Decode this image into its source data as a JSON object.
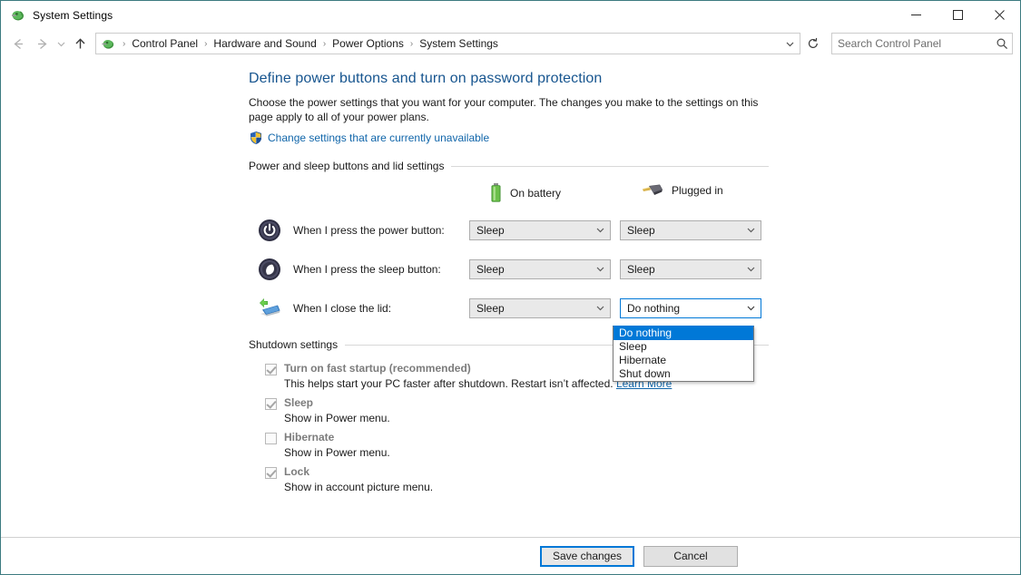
{
  "window": {
    "title": "System Settings",
    "icon": "power-options-icon",
    "caption": {
      "minimize": "minimize-icon",
      "maximize": "maximize-icon",
      "close": "close-icon"
    }
  },
  "addressbar": {
    "back": "back-arrow-icon",
    "forward": "forward-arrow-icon",
    "recent": "recent-pages-icon",
    "up": "up-arrow-icon",
    "breadcrumbs": [
      "Control Panel",
      "Hardware and Sound",
      "Power Options",
      "System Settings"
    ],
    "separator": "›",
    "dropdown": "chevron-down-icon",
    "refresh": "refresh-icon",
    "search": {
      "placeholder": "Search Control Panel",
      "value": "",
      "icon": "search-icon"
    }
  },
  "main": {
    "page_title": "Define power buttons and turn on password protection",
    "description": "Choose the power settings that you want for your computer. The changes you make to the settings on this page apply to all of your power plans.",
    "uac_link": "Change settings that are currently unavailable",
    "group_label": "Power and sleep buttons and lid settings",
    "columns": [
      {
        "label": "On battery",
        "icon": "battery-icon"
      },
      {
        "label": "Plugged in",
        "icon": "power-plug-icon"
      }
    ],
    "rows": [
      {
        "icon": "power-button-icon",
        "label": "When I press the power button:",
        "on_battery": "Sleep",
        "plugged_in": "Sleep"
      },
      {
        "icon": "sleep-button-icon",
        "label": "When I press the sleep button:",
        "on_battery": "Sleep",
        "plugged_in": "Sleep"
      },
      {
        "icon": "laptop-lid-icon",
        "label": "When I close the lid:",
        "on_battery": "Sleep",
        "plugged_in": "Do nothing"
      }
    ],
    "open_dropdown": {
      "selected": "Do nothing",
      "options": [
        "Do nothing",
        "Sleep",
        "Hibernate",
        "Shut down"
      ]
    },
    "shutdown": {
      "group_label": "Shutdown settings",
      "items": [
        {
          "label": "Turn on fast startup (recommended)",
          "checked": true,
          "description": "This helps start your PC faster after shutdown. Restart isn’t affected.",
          "link": "Learn More"
        },
        {
          "label": "Sleep",
          "checked": true,
          "description": "Show in Power menu.",
          "link": ""
        },
        {
          "label": "Hibernate",
          "checked": false,
          "description": "Show in Power menu.",
          "link": ""
        },
        {
          "label": "Lock",
          "checked": true,
          "description": "Show in account picture menu.",
          "link": ""
        }
      ]
    }
  },
  "footer": {
    "save_label": "Save changes",
    "cancel_label": "Cancel"
  },
  "colors": {
    "accent": "#0078d7",
    "title_link": "#17558f",
    "link": "#1166aa",
    "disabled_text": "#7c7c7c"
  }
}
